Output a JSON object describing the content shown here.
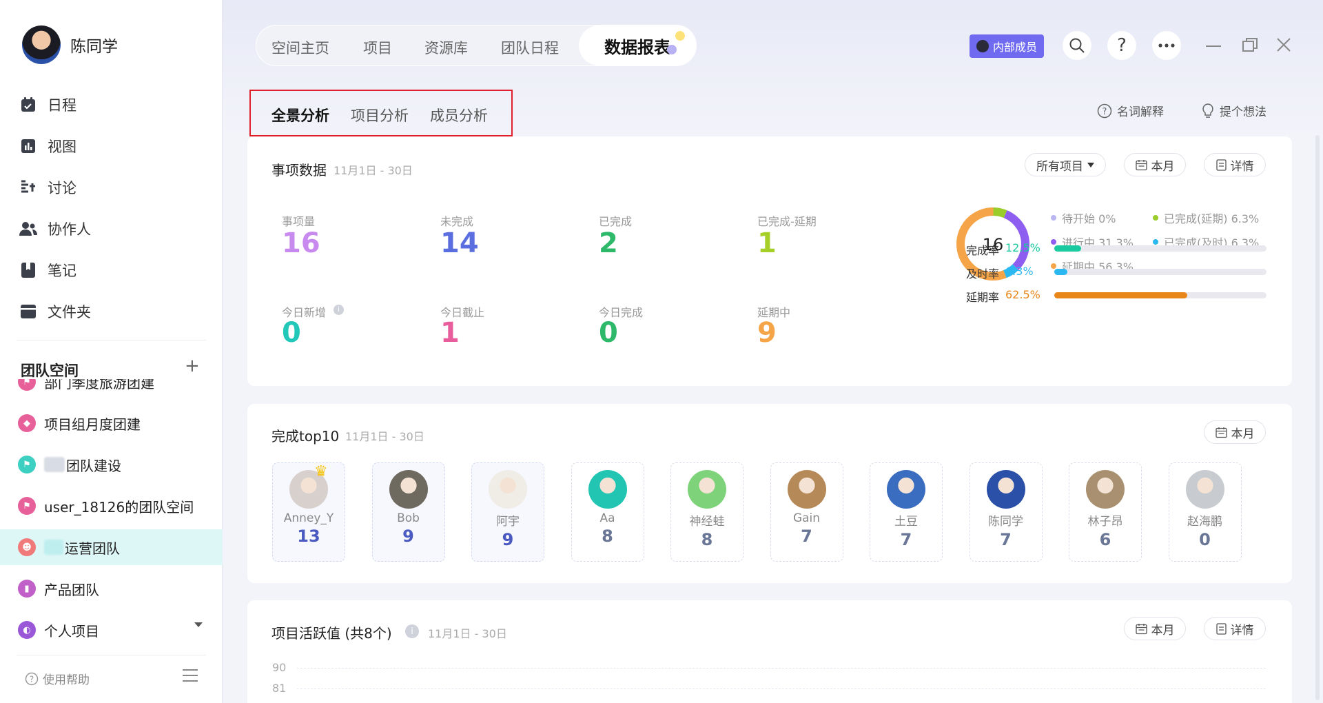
{
  "user": {
    "name": "陈同学"
  },
  "nav": [
    {
      "label": "日程",
      "icon": "calendar-icon"
    },
    {
      "label": "视图",
      "icon": "chart-view-icon"
    },
    {
      "label": "讨论",
      "icon": "discussion-icon"
    },
    {
      "label": "协作人",
      "icon": "people-icon"
    },
    {
      "label": "笔记",
      "icon": "note-icon"
    },
    {
      "label": "文件夹",
      "icon": "folder-icon"
    }
  ],
  "team_space": {
    "title": "团队空间",
    "add_label": "+",
    "items": [
      {
        "label": "部门季度旅游团建",
        "color": "#e8609a"
      },
      {
        "label": "项目组月度团建",
        "color": "#e8609a"
      },
      {
        "label": "团队建设",
        "color": "#3ccfc2"
      },
      {
        "label": "user_18126的团队空间",
        "color": "#e8609a"
      },
      {
        "label": "运营团队",
        "color": "#f07a7a"
      },
      {
        "label": "产品团队",
        "color": "#c060c8"
      },
      {
        "label": "个人项目",
        "color": "#9a58d8"
      }
    ]
  },
  "help": {
    "label": "使用帮助"
  },
  "top_tabs": [
    {
      "label": "空间主页"
    },
    {
      "label": "项目"
    },
    {
      "label": "资源库"
    },
    {
      "label": "团队日程"
    },
    {
      "label": "数据报表"
    }
  ],
  "header": {
    "badge": "内部成员"
  },
  "sub_tabs": [
    {
      "label": "全景分析"
    },
    {
      "label": "项目分析"
    },
    {
      "label": "成员分析"
    }
  ],
  "top_links": {
    "glossary": "名词解释",
    "feedback": "提个想法"
  },
  "events": {
    "title": "事项数据",
    "date": "11月1日 - 30日",
    "filter": "所有项目",
    "month_btn": "本月",
    "detail_btn": "详情",
    "stats": [
      {
        "label": "事项量",
        "value": "16",
        "color": "#c98af0"
      },
      {
        "label": "未完成",
        "value": "14",
        "color": "#5b6ee0"
      },
      {
        "label": "已完成",
        "value": "2",
        "color": "#2db86a"
      },
      {
        "label": "已完成-延期",
        "value": "1",
        "color": "#a6cf2a"
      },
      {
        "label": "今日新增",
        "value": "0",
        "color": "#21c7b8"
      },
      {
        "label": "今日截止",
        "value": "1",
        "color": "#e85d9c"
      },
      {
        "label": "今日完成",
        "value": "0",
        "color": "#2db86a"
      },
      {
        "label": "延期中",
        "value": "9",
        "color": "#f5a547"
      }
    ],
    "donut_total": "16",
    "donut": [
      {
        "label": "待开始 0%",
        "value": 0,
        "color": "#b9b5f0"
      },
      {
        "label": "进行中 31.3%",
        "value": 31.3,
        "color": "#8e5ef0"
      },
      {
        "label": "延期中 56.3%",
        "value": 56.3,
        "color": "#f5a547"
      },
      {
        "label": "已完成(延期) 6.3%",
        "value": 6.3,
        "color": "#9acd2a"
      },
      {
        "label": "已完成(及时) 6.3%",
        "value": 6.3,
        "color": "#2bb8f0"
      }
    ],
    "rates": [
      {
        "label": "完成率",
        "value": "12.5%",
        "pct": 12.5,
        "color": "#19c9a0"
      },
      {
        "label": "及时率",
        "value": "6.3%",
        "pct": 6.3,
        "color": "#2bb8f0"
      },
      {
        "label": "延期率",
        "value": "62.5%",
        "pct": 62.5,
        "color": "#e8861a"
      }
    ]
  },
  "top10": {
    "title": "完成top10",
    "date": "11月1日 - 30日",
    "month_btn": "本月",
    "members": [
      {
        "name": "Anney_Y",
        "count": "13",
        "avatar": "#d8d0cc"
      },
      {
        "name": "Bob",
        "count": "9",
        "avatar": "#6f6a60"
      },
      {
        "name": "阿宇",
        "count": "9",
        "avatar": "#f0ece6"
      },
      {
        "name": "Aa",
        "count": "8",
        "avatar": "#22c4b2"
      },
      {
        "name": "神经蛙",
        "count": "8",
        "avatar": "#7ed37a"
      },
      {
        "name": "Gain",
        "count": "7",
        "avatar": "#b58a58"
      },
      {
        "name": "土豆",
        "count": "7",
        "avatar": "#3a6cc0"
      },
      {
        "name": "陈同学",
        "count": "7",
        "avatar": "#2b50a8"
      },
      {
        "name": "林子昂",
        "count": "6",
        "avatar": "#a89070"
      },
      {
        "name": "赵海鹏",
        "count": "0",
        "avatar": "#c8ccd0"
      }
    ]
  },
  "activity": {
    "title": "项目活跃值 (共8个)",
    "date": "11月1日 - 30日",
    "month_btn": "本月",
    "detail_btn": "详情",
    "yticks": [
      "90",
      "81"
    ]
  }
}
